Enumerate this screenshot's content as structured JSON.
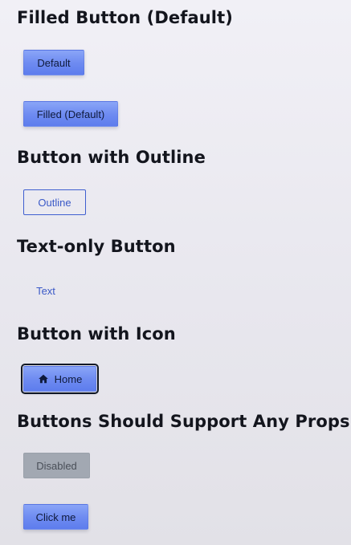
{
  "sections": {
    "filled": {
      "heading": "Filled Button (Default)",
      "default_label": "Default",
      "filled_label": "Filled (Default)"
    },
    "outline": {
      "heading": "Button with Outline",
      "label": "Outline"
    },
    "text_only": {
      "heading": "Text-only Button",
      "label": "Text"
    },
    "icon": {
      "heading": "Button with Icon",
      "label": "Home",
      "icon_name": "home-icon"
    },
    "props": {
      "heading": "Buttons Should Support Any Props",
      "disabled_label": "Disabled",
      "click_label": "Click me"
    }
  },
  "colors": {
    "primary": "#6f8cf1",
    "outline": "#3f5fd0",
    "disabled": "#a2a8b2",
    "focus_ring": "#111826"
  }
}
